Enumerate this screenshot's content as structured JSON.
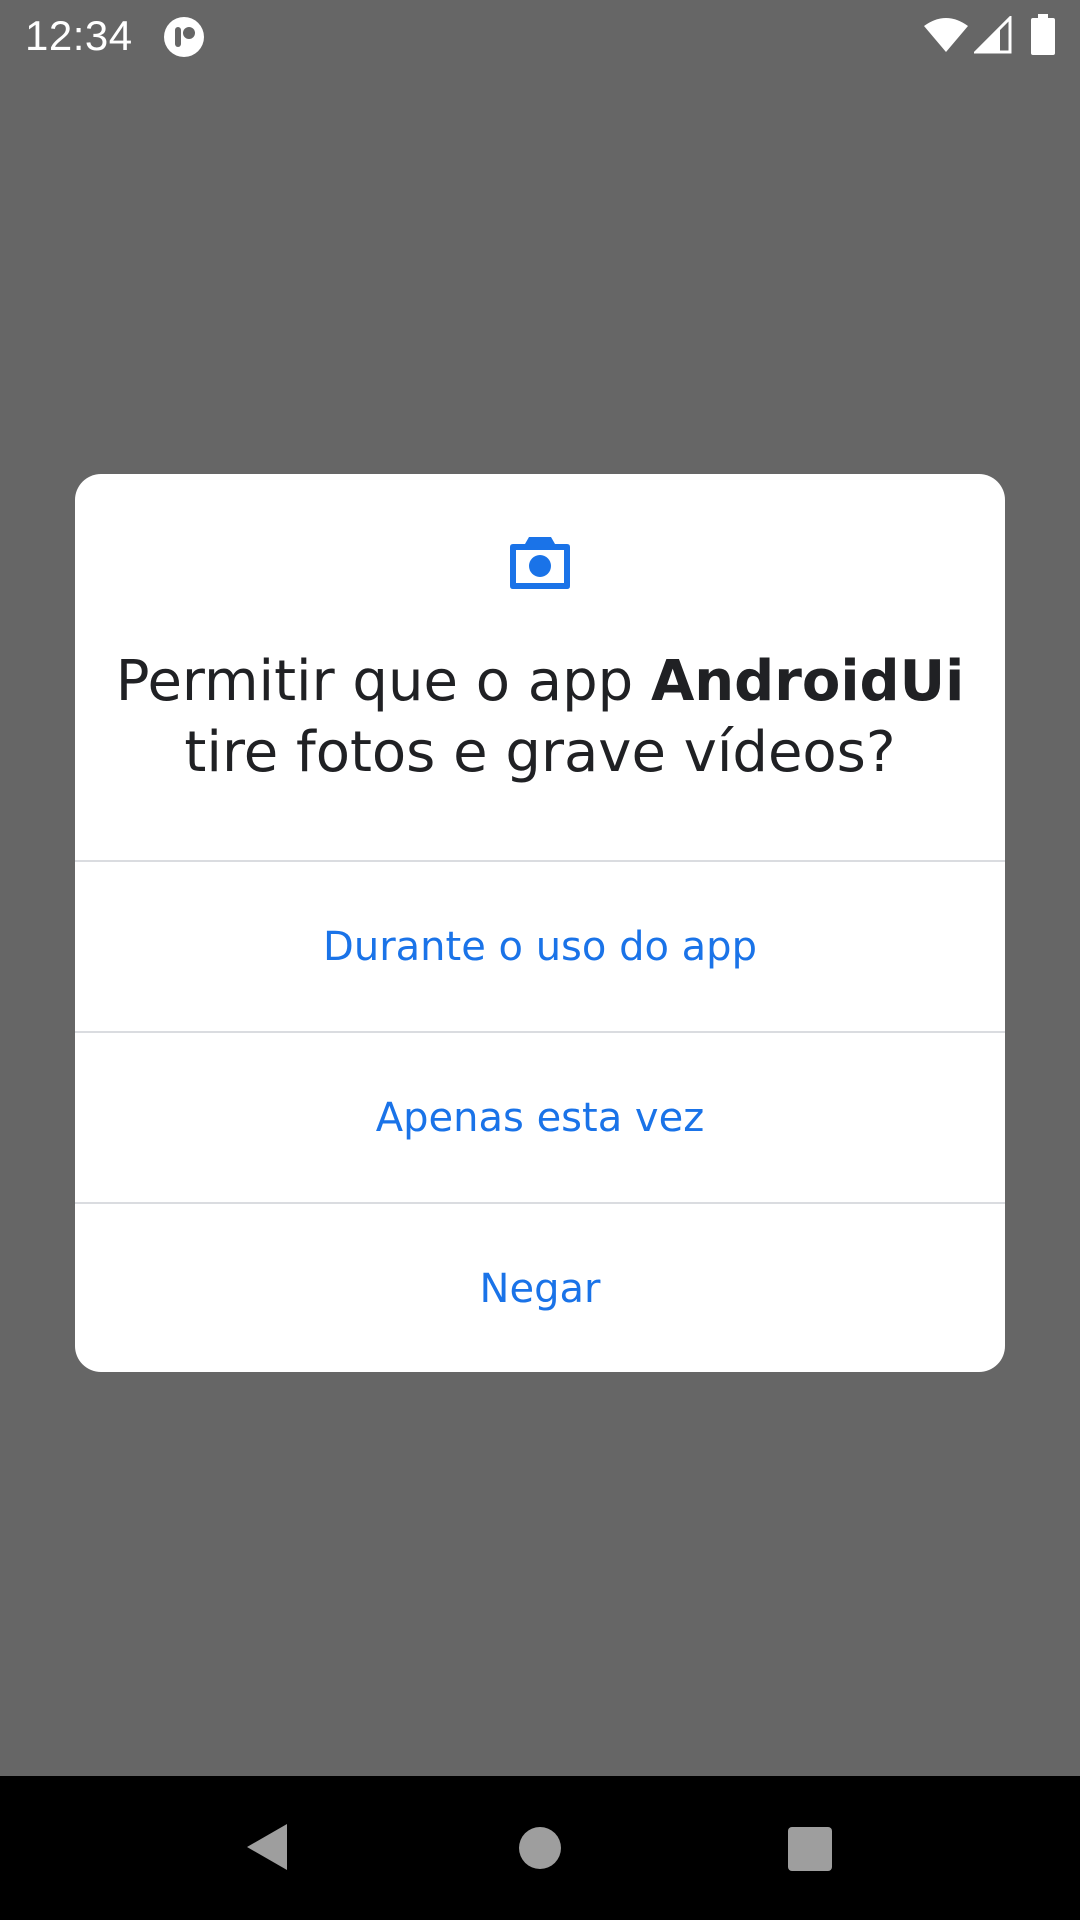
{
  "status_bar": {
    "time": "12:34",
    "icons": [
      "app-notification-icon",
      "wifi-icon",
      "signal-icon",
      "battery-icon"
    ]
  },
  "dialog": {
    "icon": "camera-icon",
    "title_prefix": "Permitir que o app ",
    "title_app": "AndroidUi",
    "title_suffix": " tire fotos e grave vídeos?",
    "options": [
      {
        "label": "Durante o uso do app"
      },
      {
        "label": "Apenas esta vez"
      },
      {
        "label": "Negar"
      }
    ],
    "accent_color": "#1a73e8"
  },
  "nav_bar": {
    "icons": [
      "back-icon",
      "home-icon",
      "recents-icon"
    ]
  }
}
